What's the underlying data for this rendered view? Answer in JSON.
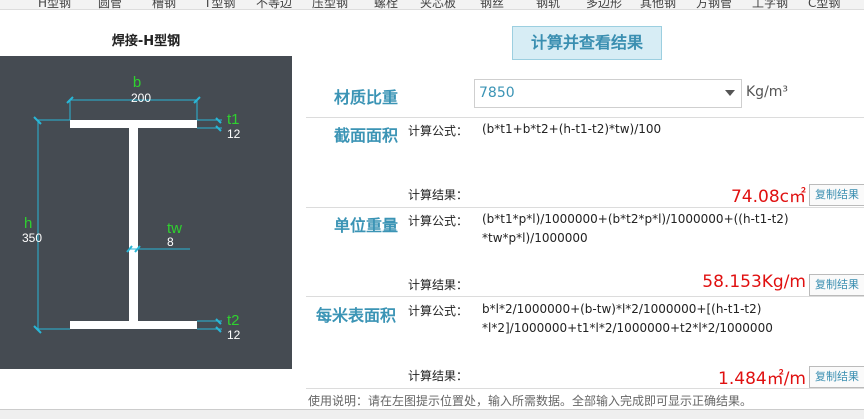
{
  "nav": {
    "tabs": [
      "H型钢",
      "圆管",
      "槽钢",
      "T型钢",
      "不等边",
      "压型钢",
      "螺栓",
      "夹芯板",
      "钢丝",
      "钢轨",
      "多边形",
      "其他钢",
      "方钢管",
      "工字钢",
      "C型钢"
    ]
  },
  "left": {
    "title": "焊接-H型钢",
    "dims": {
      "b_label": "b",
      "b_value": "200",
      "t1_label": "t1",
      "t1_value": "12",
      "h_label": "h",
      "h_value": "350",
      "tw_label": "tw",
      "tw_value": "8",
      "t2_label": "t2",
      "t2_value": "12"
    }
  },
  "calc_button": "计算并查看结果",
  "density": {
    "label": "材质比重",
    "value": "7850",
    "unit": "Kg/m³"
  },
  "sections": [
    {
      "label": "截面面积",
      "formula_label": "计算公式：",
      "formula_line1": "(b*t1+b*t2+(h-t1-t2)*tw)/100",
      "formula_line2": "",
      "result_label": "计算结果：",
      "result": "74.08c㎡",
      "copy": "复制结果"
    },
    {
      "label": "单位重量",
      "formula_label": "计算公式：",
      "formula_line1": "(b*t1*p*l)/1000000+(b*t2*p*l)/1000000+((h-t1-t2)",
      "formula_line2": "*tw*p*l)/1000000",
      "result_label": "计算结果：",
      "result": "58.153Kg/m",
      "copy": "复制结果"
    },
    {
      "label": "每米表面积",
      "formula_label": "计算公式：",
      "formula_line1": "b*l*2/1000000+(b-tw)*l*2/1000000+[(h-t1-t2)",
      "formula_line2": "*l*2]/1000000+t1*l*2/1000000+t2*l*2/1000000",
      "result_label": "计算结果：",
      "result": "1.484㎡/m",
      "copy": "复制结果"
    }
  ],
  "note": "使用说明：请在左图提示位置处，输入所需数据。全部输入完成即可显示正确结果。",
  "colors": {
    "accent": "#3b94b5",
    "result_red": "#e01010",
    "dim_green": "#2fd12f",
    "dim_cyan": "#29b6d6",
    "diagram_bg": "#454b52"
  }
}
